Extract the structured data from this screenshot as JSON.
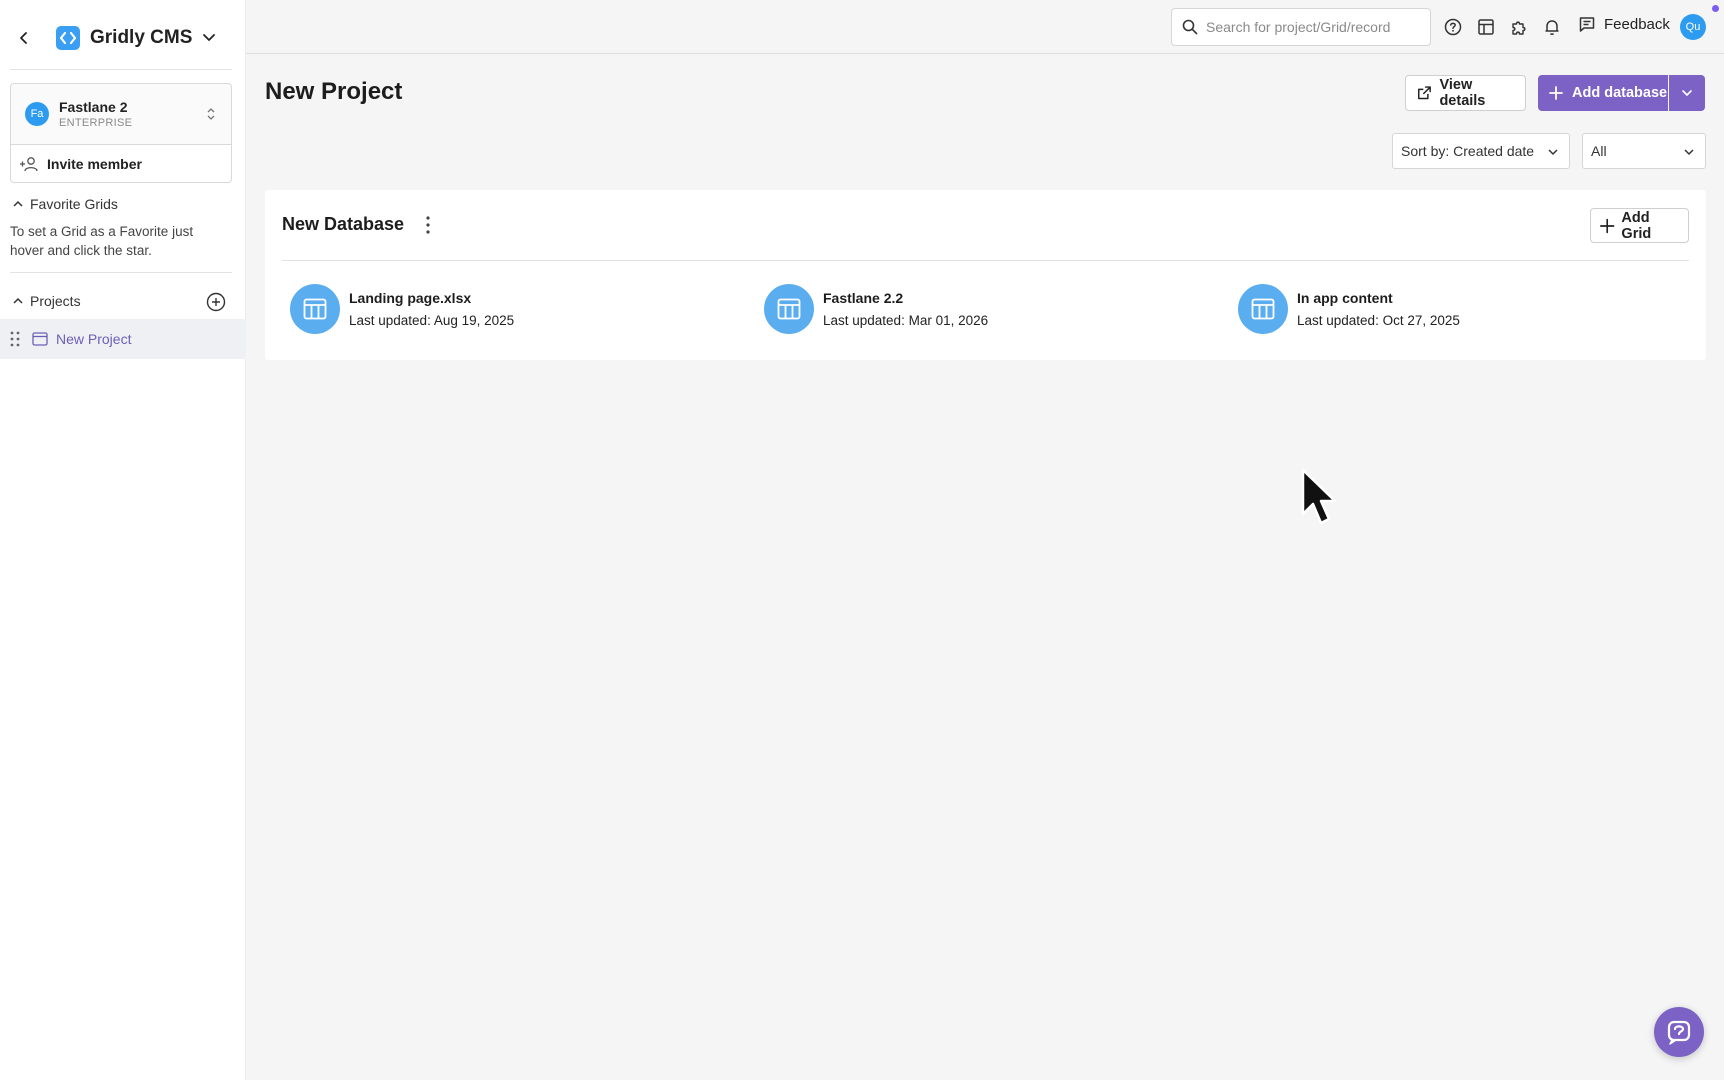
{
  "app": {
    "name": "Gridly CMS"
  },
  "workspace": {
    "avatar": "Fa",
    "name": "Fastlane 2",
    "plan": "ENTERPRISE",
    "invite_label": "Invite member"
  },
  "favorites": {
    "heading": "Favorite Grids",
    "help": "To set a Grid as a Favorite just hover and click the star."
  },
  "projects": {
    "heading": "Projects",
    "items": [
      {
        "label": "New Project",
        "active": true
      }
    ]
  },
  "topbar": {
    "search_placeholder": "Search for project/Grid/record",
    "feedback_label": "Feedback",
    "user_avatar": "Qu",
    "icons": [
      "help-circle-icon",
      "layout-icon",
      "puzzle-icon",
      "bell-icon",
      "feedback-icon"
    ]
  },
  "page": {
    "title": "New Project",
    "view_details_label": "View details",
    "add_database_label": "Add database",
    "sort_label": "Sort by: Created date",
    "filter_value": "All"
  },
  "database": {
    "name": "New Database",
    "add_grid_label": "Add Grid",
    "grids": [
      {
        "name": "Landing page.xlsx",
        "updated": "Last updated: Aug 19, 2025"
      },
      {
        "name": "Fastlane 2.2",
        "updated": "Last updated: Mar 01, 2026"
      },
      {
        "name": "In app content",
        "updated": "Last updated: Oct 27, 2025"
      }
    ]
  },
  "colors": {
    "primary": "#7c62c4",
    "grid_icon": "#5aaef0",
    "avatar": "#2d9cf0",
    "active_project_text": "#6b5fb8"
  }
}
